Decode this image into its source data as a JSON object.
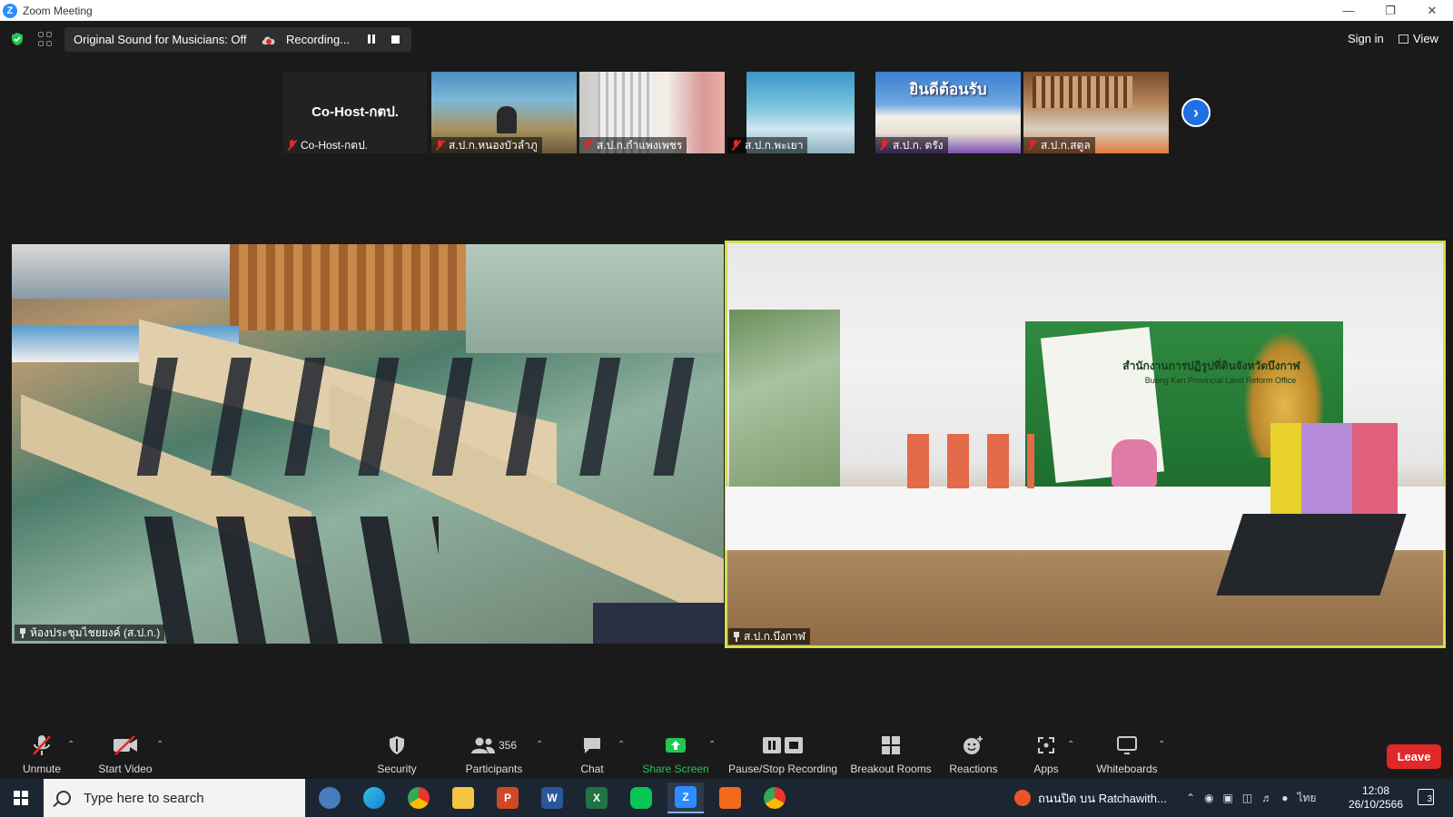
{
  "window": {
    "title": "Zoom Meeting"
  },
  "topbar": {
    "original_sound": "Original Sound for Musicians: Off",
    "recording_label": "Recording...",
    "signin": "Sign in",
    "view": "View"
  },
  "thumbnails": [
    {
      "name": "Co-Host-กตป.",
      "title": "Co-Host-กตป."
    },
    {
      "name": "ส.ป.ก.หนองบัวลำภู"
    },
    {
      "name": "ส.ป.ก.กำแพงเพชร"
    },
    {
      "name": "ส.ป.ก.พะเยา"
    },
    {
      "name": "ส.ป.ก. ตรัง",
      "banner": "ยินดีต้อนรับ"
    },
    {
      "name": "ส.ป.ก.สตูล"
    }
  ],
  "videos": [
    {
      "name": "ห้องประชุมไชยยงค์ (ส.ป.ก.)"
    },
    {
      "name": "ส.ป.ก.บึงกาฬ",
      "sign_th": "สำนักงานการปฏิรูปที่ดินจังหวัดบึงกาฬ",
      "sign_en": "Bueng Kan Provincial Land Reform Office"
    }
  ],
  "toolbar": {
    "unmute": "Unmute",
    "start_video": "Start Video",
    "security": "Security",
    "participants": "Participants",
    "participants_count": "356",
    "chat": "Chat",
    "share_screen": "Share Screen",
    "pause_stop_recording": "Pause/Stop Recording",
    "breakout_rooms": "Breakout Rooms",
    "reactions": "Reactions",
    "apps": "Apps",
    "whiteboards": "Whiteboards",
    "leave": "Leave"
  },
  "taskbar": {
    "search_placeholder": "Type here to search",
    "traffic_text": "ถนนปิด บน Ratchawith...",
    "lang": "ไทย",
    "time": "12:08",
    "date": "26/10/2566",
    "notif_count": "3"
  },
  "colors": {
    "accent": "#2d8cff",
    "active_speaker": "#cfe04c",
    "leave": "#e02828",
    "share": "#23c552"
  }
}
